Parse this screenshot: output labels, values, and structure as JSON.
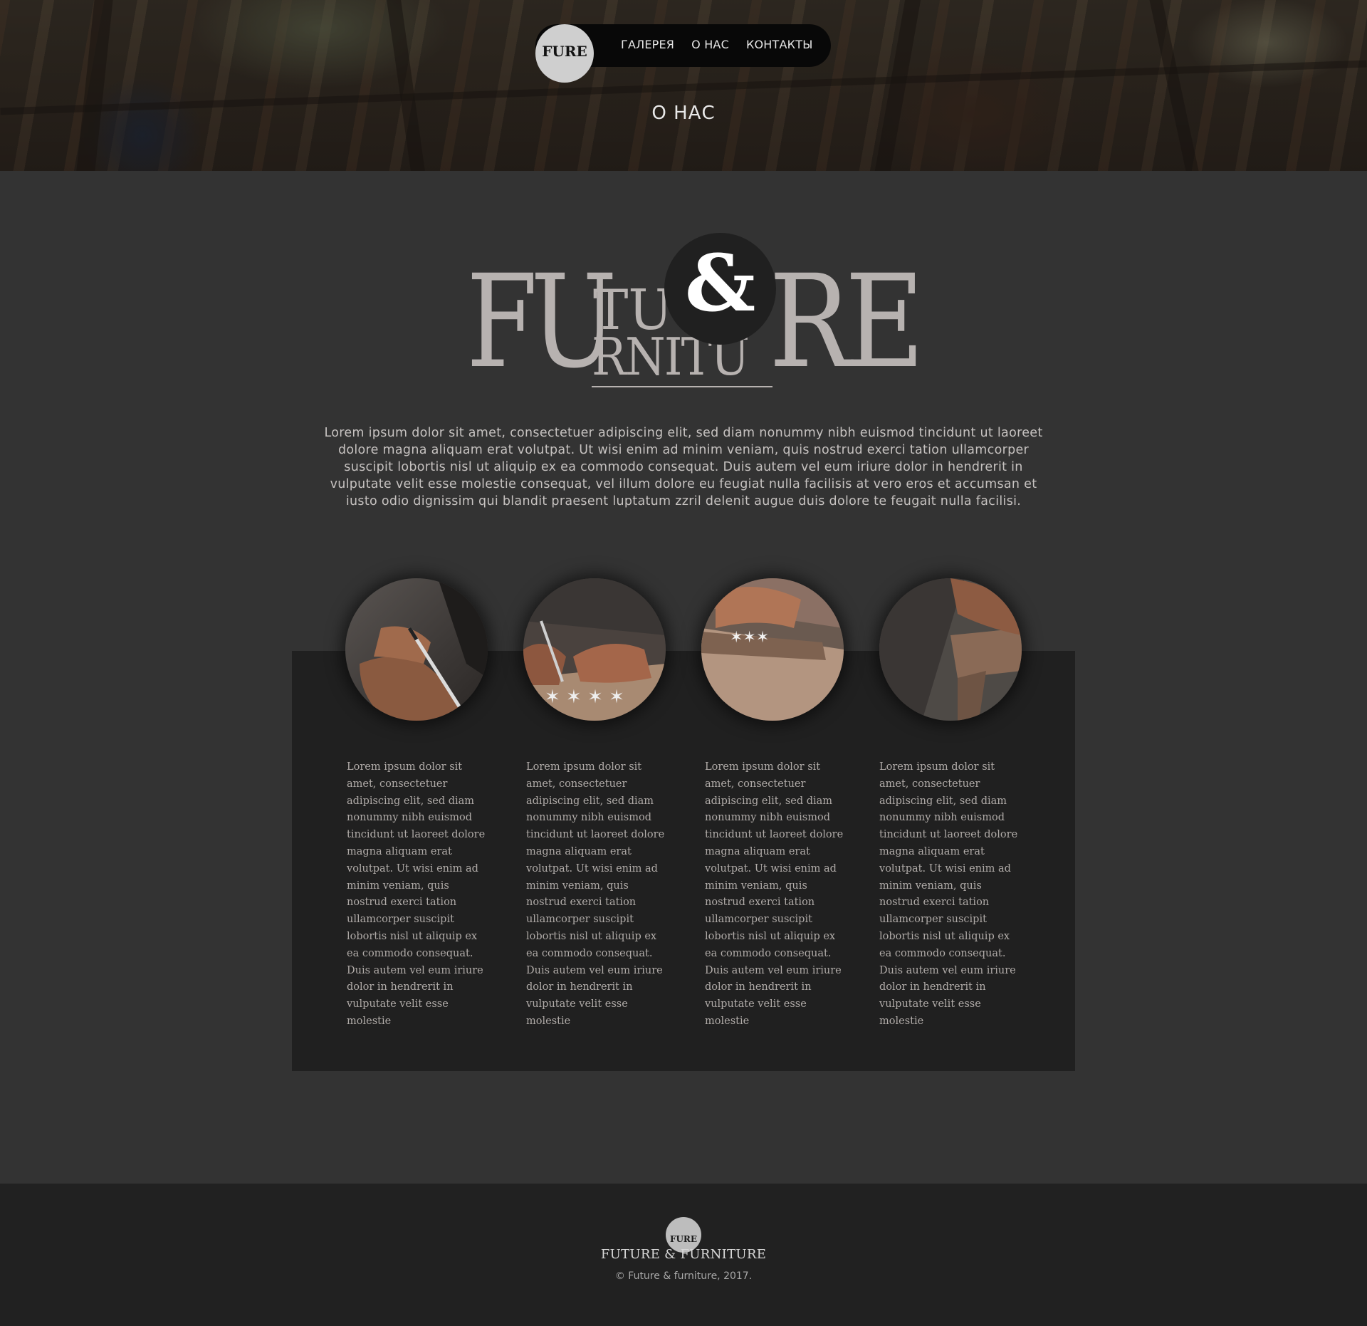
{
  "nav": {
    "logo": "FURE",
    "items": [
      {
        "label": "ГАЛЕРЕЯ"
      },
      {
        "label": "О НАС"
      },
      {
        "label": "КОНТАКТЫ"
      }
    ]
  },
  "hero": {
    "title": "О НАС"
  },
  "brand_logo": {
    "left": "FU",
    "top_middle": "TU",
    "bottom_middle": "RNITU",
    "right": "RE",
    "ampersand": "&"
  },
  "intro": {
    "text": "Lorem ipsum dolor sit amet, consectetuer adipiscing elit, sed diam nonummy nibh euismod tincidunt ut laoreet dolore magna aliquam erat volutpat. Ut wisi enim ad minim veniam, quis nostrud exerci tation ullamcorper suscipit lobortis nisl ut aliquip ex ea commodo consequat. Duis autem vel eum iriure dolor in hendrerit in vulputate velit esse molestie consequat, vel illum dolore eu feugiat nulla facilisis at vero eros et accumsan et iusto odio dignissim qui blandit praesent luptatum zzril delenit augue duis dolore te feugait nulla facilisi."
  },
  "features": [
    {
      "image": "hand-writing-with-pen",
      "text": "Lorem ipsum dolor sit amet, consectetuer adipiscing elit, sed diam nonummy nibh euismod tincidunt ut laoreet dolore magna aliquam erat volutpat. Ut wisi enim ad minim veniam, quis nostrud exerci tation ullamcorper suscipit lobortis nisl ut aliquip ex ea commodo consequat. Duis autem vel eum iriure dolor in hendrerit in vulputate velit esse molestie"
    },
    {
      "image": "hands-marking-stars-on-wood",
      "text": "Lorem ipsum dolor sit amet, consectetuer adipiscing elit, sed diam nonummy nibh euismod tincidunt ut laoreet dolore magna aliquam erat volutpat. Ut wisi enim ad minim veniam, quis nostrud exerci tation ullamcorper suscipit lobortis nisl ut aliquip ex ea commodo consequat. Duis autem vel eum iriure dolor in hendrerit in vulputate velit esse molestie"
    },
    {
      "image": "hands-on-wood-plank",
      "text": "Lorem ipsum dolor sit amet, consectetuer adipiscing elit, sed diam nonummy nibh euismod tincidunt ut laoreet dolore magna aliquam erat volutpat. Ut wisi enim ad minim veniam, quis nostrud exerci tation ullamcorper suscipit lobortis nisl ut aliquip ex ea commodo consequat. Duis autem vel eum iriure dolor in hendrerit in vulputate velit esse molestie"
    },
    {
      "image": "hand-carving-wood",
      "text": "Lorem ipsum dolor sit amet, consectetuer adipiscing elit, sed diam nonummy nibh euismod tincidunt ut laoreet dolore magna aliquam erat volutpat. Ut wisi enim ad minim veniam, quis nostrud exerci tation ullamcorper suscipit lobortis nisl ut aliquip ex ea commodo consequat. Duis autem vel eum iriure dolor in hendrerit in vulputate velit esse molestie"
    }
  ],
  "footer": {
    "logo": "FURE",
    "name": "FUTURE & FURNITURE",
    "copyright": "© Future & furniture, 2017."
  },
  "colors": {
    "page_bg": "#333333",
    "panel_bg": "#202020",
    "footer_bg": "#212121",
    "navbar_bg": "#080808",
    "logo_text": "#b7b2b0"
  }
}
